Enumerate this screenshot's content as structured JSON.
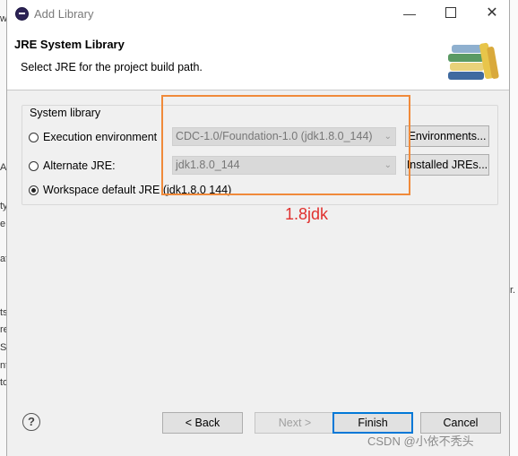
{
  "background": {
    "left_fragments": [
      "w",
      "A",
      "ty",
      "e",
      "at",
      "ts",
      "re",
      "Se",
      "nt",
      "to"
    ],
    "right_fragments": [
      "",
      "",
      "r.",
      "",
      ""
    ]
  },
  "window": {
    "title": "Add Library"
  },
  "header": {
    "title": "JRE System Library",
    "subtitle": "Select JRE for the project build path."
  },
  "group": {
    "label": "System library",
    "options": [
      {
        "label": "Execution environment",
        "checked": false,
        "combo": "CDC-1.0/Foundation-1.0 (jdk1.8.0_144)",
        "button": "Environments..."
      },
      {
        "label": "Alternate JRE:",
        "checked": false,
        "combo": "jdk1.8.0_144",
        "button": "Installed JREs..."
      },
      {
        "label": "Workspace default JRE (jdk1.8.0 144)",
        "checked": true
      }
    ]
  },
  "annotation": {
    "text": "1.8jdk",
    "color": "#f08a3a",
    "text_color": "#e0302e"
  },
  "footer": {
    "help": "?",
    "back": "< Back",
    "next": "Next >",
    "finish": "Finish",
    "cancel": "Cancel"
  },
  "watermark": "CSDN @小依不秃头"
}
